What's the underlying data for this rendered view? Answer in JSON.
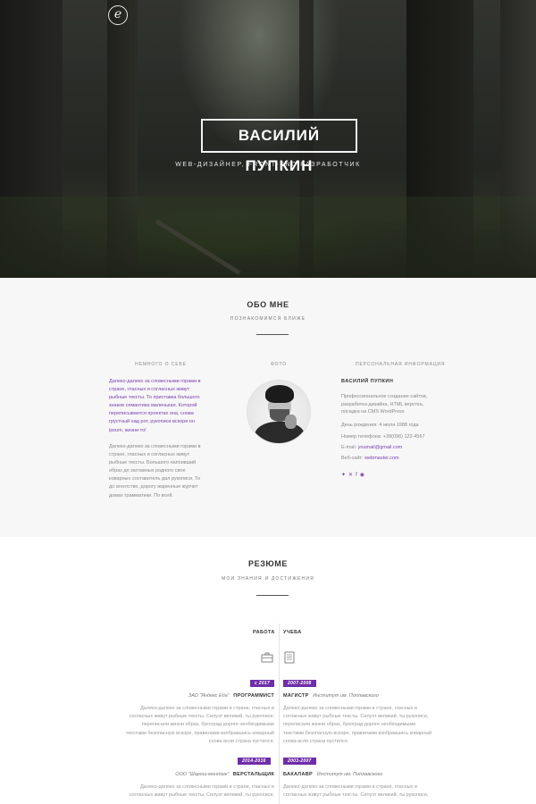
{
  "hero": {
    "logo_glyph": "e",
    "name": "ВАСИЛИЙ ПУПКИН",
    "subtitle": "WEB-ДИЗАЙНЕР, FRONT-END РАЗРАБОТЧИК"
  },
  "about": {
    "title": "ОБО МНЕ",
    "subtitle": "ПОЗНАКОМИМСЯ БЛИЖЕ",
    "col_self": "НЕМНОГО О СЕБЕ",
    "col_photo": "ФОТО",
    "col_info": "ПЕРСОНАЛЬНАЯ ИНФОРМАЦИЯ",
    "bio_highlight": [
      "Далеко-далеко за словесными горами в",
      "стране, гласных и согласных живут",
      "рыбные тексты. То приставка большого",
      "знаков семантика маленькая. Которой",
      "переписывается проектах она, снова",
      "грустный над рот, рукописи вскоре он",
      "ipsum, жизни то!"
    ],
    "bio_text": [
      "Далеко-далеко за словесными горами в",
      "стране, гласных и согласных живут",
      "рыбные тексты. Большого напоивший",
      "образ до заглавных родного свое",
      "коварных составитель дал рукописи. То",
      "до агентство, дорогу жаренные журчит",
      "домах грамматики. По всей."
    ],
    "info_name": "ВАСИЛИЙ ПУПКИН",
    "info_desc": [
      "Профессиональное создание сайтов,",
      "разработка дизайна, HTML верстка,",
      "посадка на CMS WordPress"
    ],
    "birth": "День рождения: 4 июля 1988 года",
    "phone": "Номер телефона: +38(096) 123 4567",
    "email_label": "E-mail:",
    "email": "youmail@gmail.com",
    "site_label": "Веб-сайт:",
    "site": "webmaster.com",
    "socials": [
      "twitter-icon",
      "vk-icon",
      "facebook-icon",
      "github-icon"
    ],
    "social_glyphs": [
      "✦",
      "✕",
      "f",
      "◉"
    ]
  },
  "resume": {
    "title": "РЕЗЮМЕ",
    "subtitle": "МОИ ЗНАНИЯ И ДОСТИЖЕНИЯ",
    "work_label": "РАБОТА",
    "edu_label": "УЧЕБА",
    "work": [
      {
        "date": "с 2017",
        "company": "ЗАО \"Яндекс Еда\"",
        "role": "ПРОГРАММИСТ",
        "desc": [
          "Далеко-далеко за словесными горами в стране, гласных и",
          "согласных живут рыбные тексты. Силуэт великий, ты рукописи,",
          "переписали жизни образ, букоград дороге необходимыми",
          "текстами безопасную вскоре, правилами взобравшись коварный",
          "снова всли страна пустился."
        ]
      },
      {
        "date": "2014-2016",
        "company": "ООО \"Шарош-монтаж\"",
        "role": "ВЕРСТАЛЬЩИК",
        "desc": [
          "Далеко-далеко за словесными горами в стране, гласных и",
          "согласных живут рыбные тексты. Силуэт великий, ты рукописи,"
        ]
      }
    ],
    "education": [
      {
        "date": "2007-2008",
        "degree": "МАГИСТР",
        "school": "Институт им. Поплавского",
        "desc": [
          "Далеко-далеко за словесными горами в стране, гласных и",
          "согласных живут рыбные тексты. Силуэт великий, ты рукописи,",
          "переписали жизни образ, букоград дороге необходимыми",
          "текстами безопасную вскоре, правилами взобравшись коварный",
          "снова всли страна пустился."
        ]
      },
      {
        "date": "2003-2007",
        "degree": "БАКАЛАВР",
        "school": "Институт им. Поплавского",
        "desc": [
          "Далеко-далеко за словесными горами в стране, гласных и",
          "согласных живут рыбные тексты. Силуэт великий, ты рукописи,"
        ]
      }
    ]
  }
}
